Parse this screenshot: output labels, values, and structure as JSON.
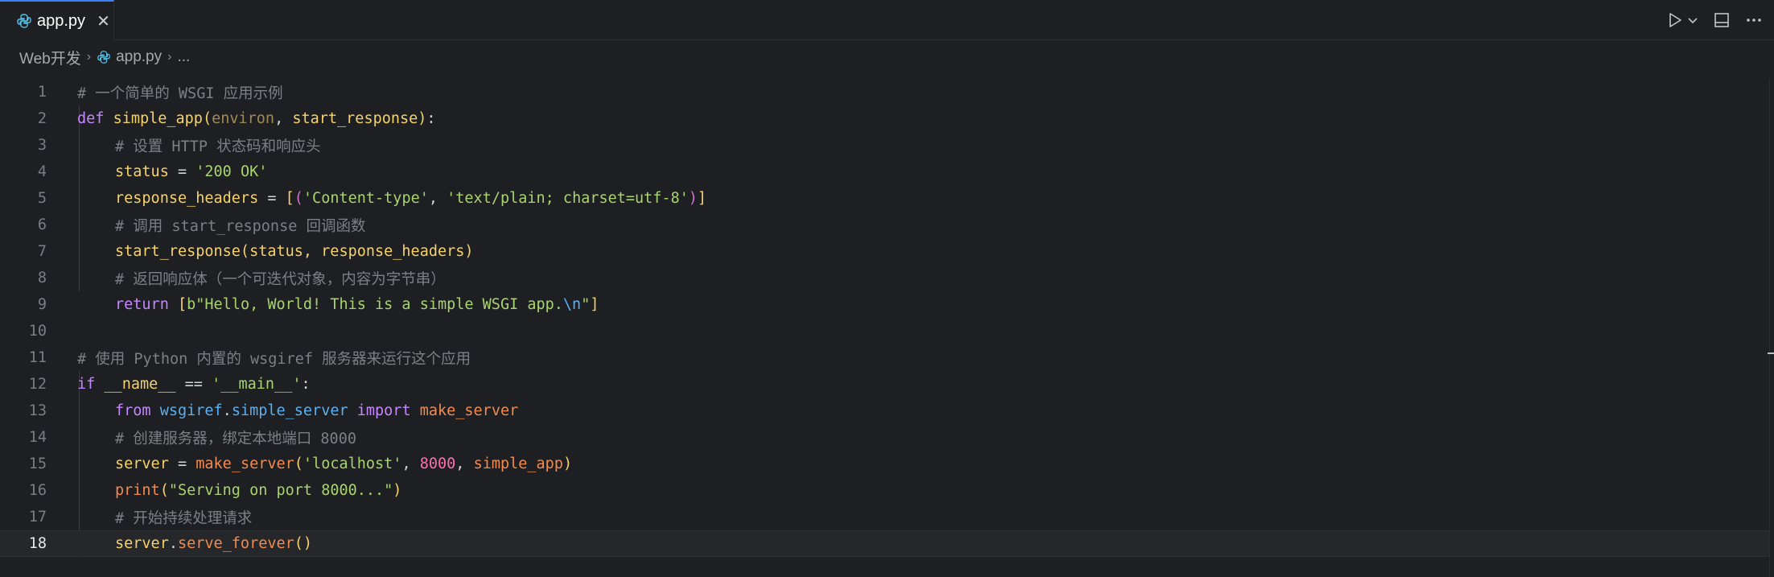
{
  "tabs": [
    {
      "label": "app.py",
      "icon": "python-file-icon",
      "active": true
    }
  ],
  "toolbar": {
    "run_icon": "play-icon",
    "run_menu_icon": "chevron-down-icon",
    "layout_icon": "split-editor-icon",
    "more_icon": "more-actions-icon"
  },
  "breadcrumb": {
    "folder": "Web开发",
    "file": "app.py",
    "symbol": "..."
  },
  "editor": {
    "line_numbers": [
      "1",
      "2",
      "3",
      "4",
      "5",
      "6",
      "7",
      "8",
      "9",
      "10",
      "11",
      "12",
      "13",
      "14",
      "15",
      "16",
      "17",
      "18"
    ],
    "current_line": 18,
    "lines": {
      "l1_comment": "# 一个简单的 WSGI 应用示例",
      "l2": {
        "def": "def",
        "name": "simple_app",
        "p1": "environ",
        "p2": "start_response"
      },
      "l3_comment": "# 设置 HTTP 状态码和响应头",
      "l4": {
        "var": "status",
        "str": "'200 OK'"
      },
      "l5": {
        "var": "response_headers",
        "s1": "'Content-type'",
        "s2": "'text/plain; charset=utf-8'"
      },
      "l6_comment": "# 调用 start_response 回调函数",
      "l7": {
        "text": "start_response(status, response_headers)"
      },
      "l8_comment": "# 返回响应体（一个可迭代对象，内容为字节串）",
      "l9": {
        "kw": "return",
        "str1": "\"Hello, World! This is a simple WSGI app.",
        "esc": "\\n",
        "str2": "\""
      },
      "l11_comment": "# 使用 Python 内置的 wsgiref 服务器来运行这个应用",
      "l12": {
        "kw": "if",
        "name": "__name__",
        "str": "'__main__'"
      },
      "l13": {
        "from": "from",
        "mod1": "wsgiref",
        "mod2": "simple_server",
        "import": "import",
        "fn": "make_server"
      },
      "l14_comment": "# 创建服务器，绑定本地端口 8000",
      "l15": {
        "var": "server",
        "fn": "make_server",
        "str": "'localhost'",
        "num": "8000",
        "arg": "simple_app"
      },
      "l16": {
        "fn": "print",
        "str": "\"Serving on port 8000...\""
      },
      "l17_comment": "# 开始持续处理请求",
      "l18": {
        "var": "server",
        "fn": "serve_forever"
      }
    }
  }
}
